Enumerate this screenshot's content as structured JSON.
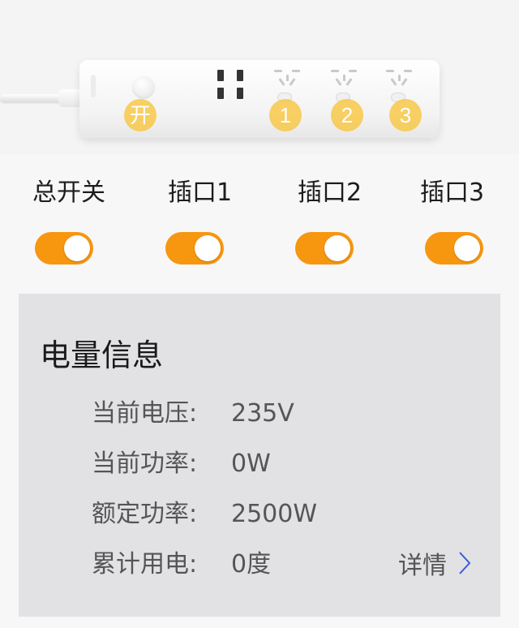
{
  "product_image": {
    "markers": {
      "main": "开",
      "outlet1": "1",
      "outlet2": "2",
      "outlet3": "3"
    },
    "marker_color": "#f7c43a"
  },
  "switches": [
    {
      "label": "总开关",
      "on": true
    },
    {
      "label": "插口1",
      "on": true
    },
    {
      "label": "插口2",
      "on": true
    },
    {
      "label": "插口3",
      "on": true
    }
  ],
  "switch_on_color": "#f7960f",
  "power_info": {
    "title": "电量信息",
    "rows": [
      {
        "label": "当前电压:",
        "value": "235V"
      },
      {
        "label": "当前功率:",
        "value": "0W"
      },
      {
        "label": "额定功率:",
        "value": "2500W"
      },
      {
        "label": "累计用电:",
        "value": "0度"
      }
    ],
    "detail_link": "详情",
    "detail_icon": "chevron-right-icon"
  }
}
